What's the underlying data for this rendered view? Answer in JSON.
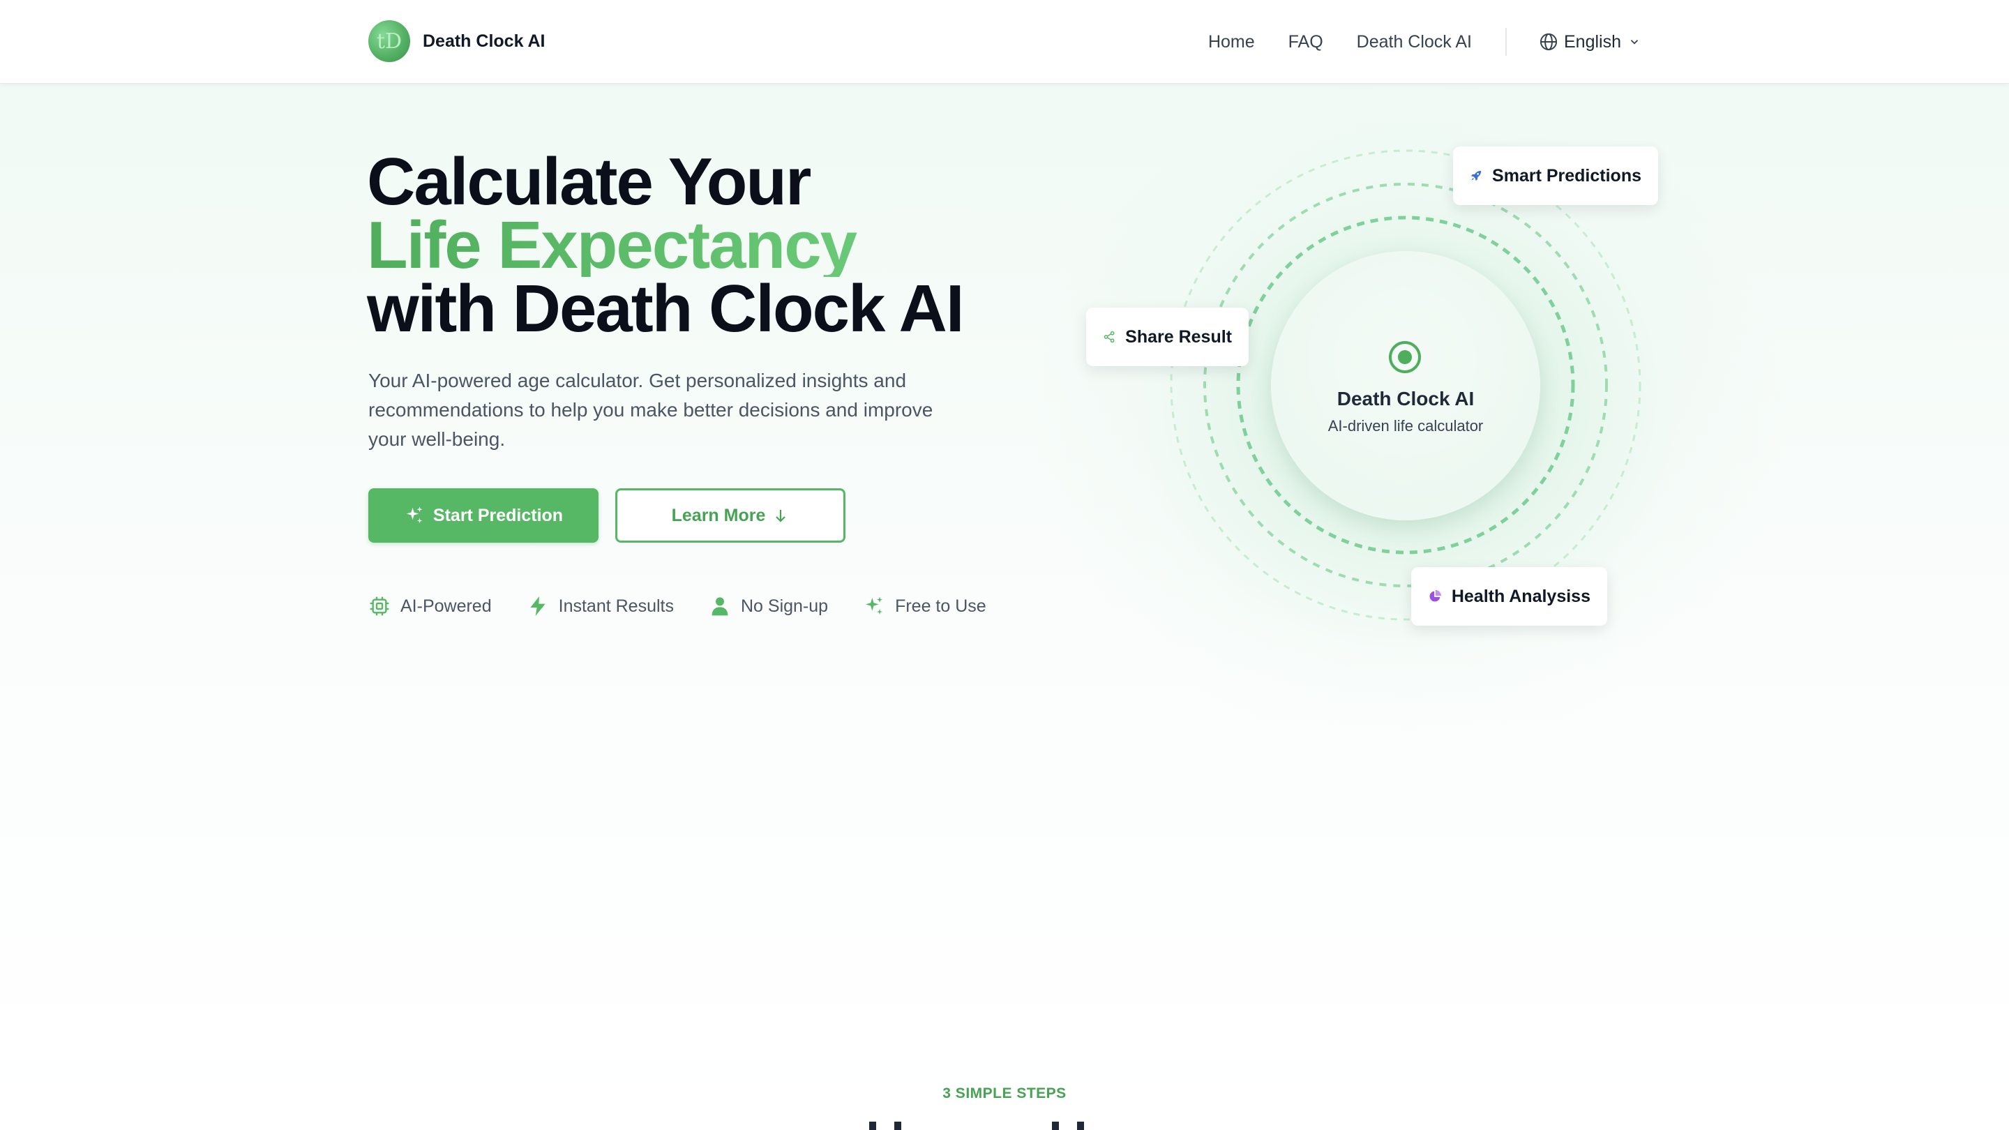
{
  "header": {
    "brand_name": "Death Clock AI",
    "logo_glyph": "tD",
    "nav": [
      "Home",
      "FAQ",
      "Death Clock AI"
    ],
    "language": "English"
  },
  "hero": {
    "title_line1": "Calculate Your",
    "title_line2": "Life Expectancy",
    "title_line3": "with Death Clock AI",
    "subtitle": "Your AI-powered age calculator. Get personalized insights and recommendations to help you make better decisions and improve your well-being.",
    "primary_button": "Start Prediction",
    "secondary_button": "Learn More",
    "features": [
      {
        "label": "AI-Powered",
        "icon": "chip-icon"
      },
      {
        "label": "Instant Results",
        "icon": "lightning-icon"
      },
      {
        "label": "No Sign-up",
        "icon": "user-icon"
      },
      {
        "label": "Free to Use",
        "icon": "sparkles-icon"
      }
    ]
  },
  "visual": {
    "center_title": "Death Clock AI",
    "center_subtitle": "AI-driven life calculator",
    "cards": {
      "smart": "Smart Predictions",
      "share": "Share Result",
      "health": "Health Analysiss"
    }
  },
  "steps": {
    "eyebrow": "3 SIMPLE STEPS"
  },
  "colors": {
    "accent": "#56b864",
    "accent_dark": "#47a354",
    "text_dark": "#0b0f1a",
    "rocket": "#3b6fd8",
    "pie": "#9b51e0"
  }
}
